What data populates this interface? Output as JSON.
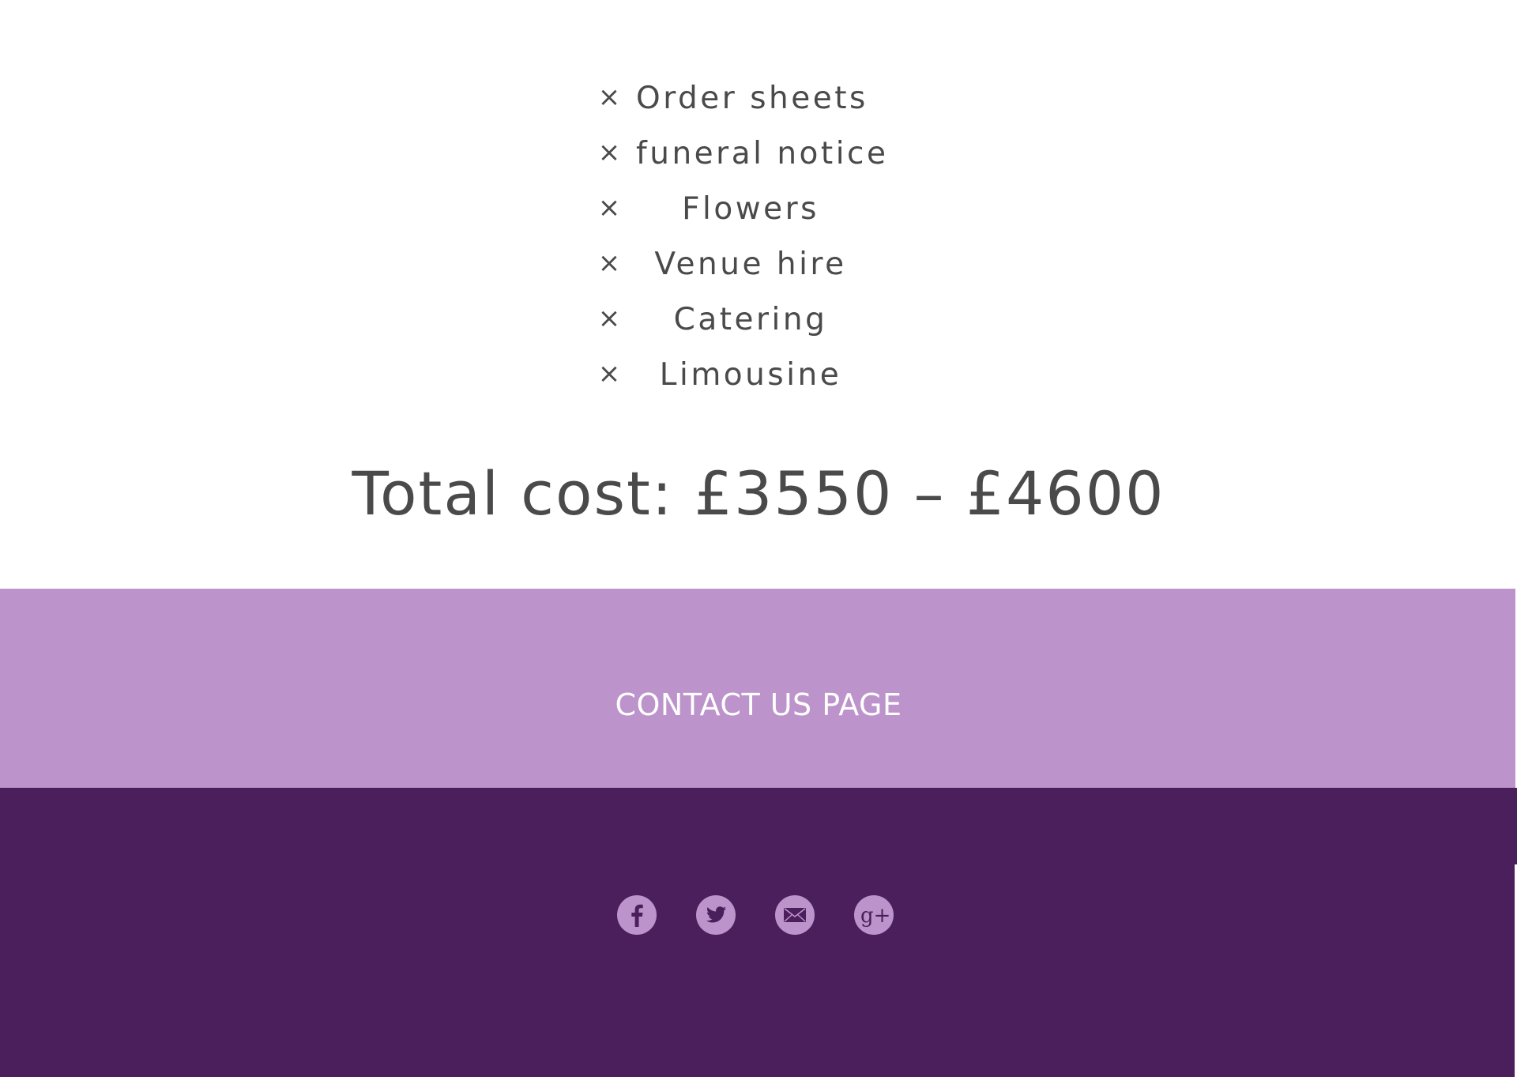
{
  "items": [
    {
      "icon": "×",
      "label": "Order sheets"
    },
    {
      "icon": "×",
      "label": "funeral notice"
    },
    {
      "icon": "×",
      "label": "Flowers"
    },
    {
      "icon": "×",
      "label": "Venue hire"
    },
    {
      "icon": "×",
      "label": "Catering"
    },
    {
      "icon": "×",
      "label": "Limousine"
    }
  ],
  "total": {
    "text": "Total cost: £3550 – £4600"
  },
  "contact": {
    "label": "CONTACT US PAGE"
  },
  "social": {
    "icons": [
      "facebook-icon",
      "twitter-icon",
      "email-icon",
      "google-plus-icon"
    ],
    "g_plus_text": "g+"
  },
  "colors": {
    "text": "#4a4a4a",
    "contact_band": "#bd93cb",
    "footer": "#4b1f5c",
    "icon_circle": "#bd93cb"
  }
}
